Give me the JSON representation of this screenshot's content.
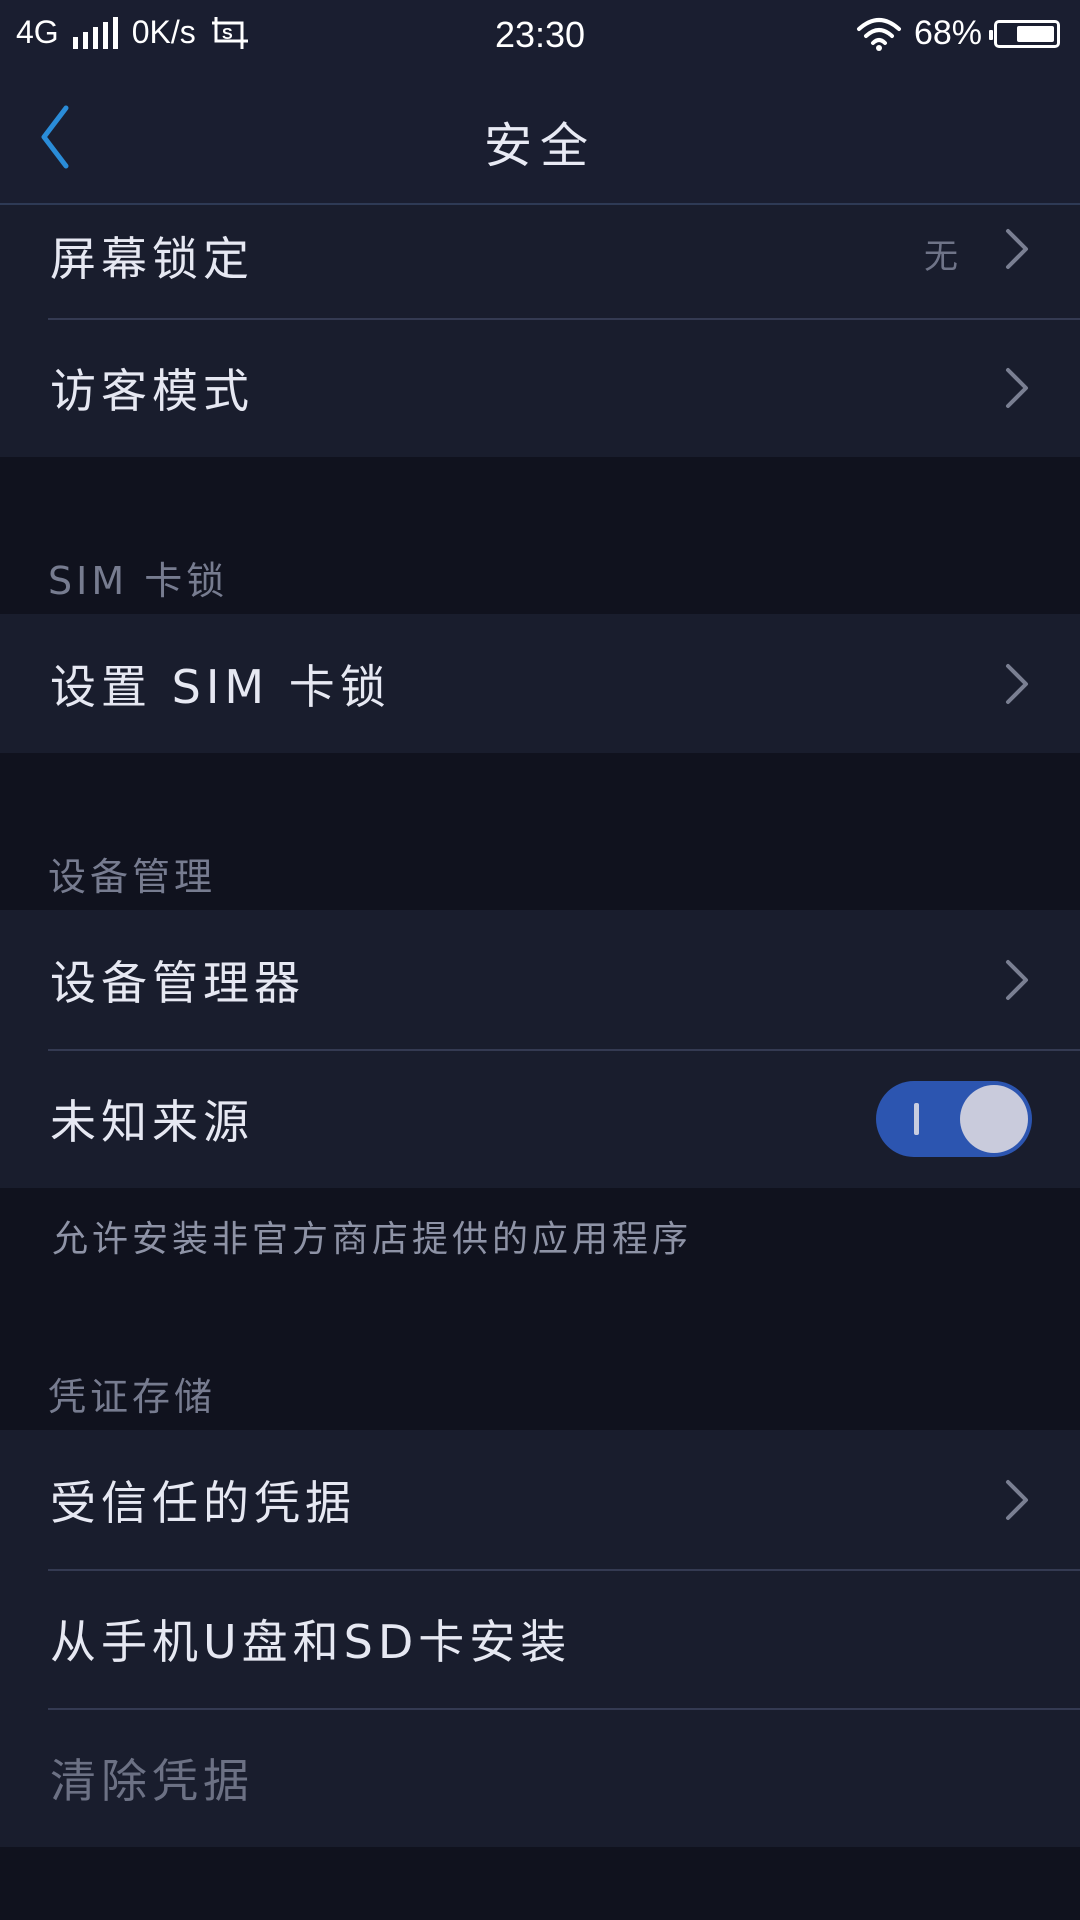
{
  "status_bar": {
    "network": "4G",
    "speed": "0K/s",
    "time": "23:30",
    "battery": "68%",
    "battery_level": 0.68
  },
  "header": {
    "title": "安全",
    "back_icon": "chevron-left-icon"
  },
  "colors": {
    "accent": "#2a8cd8",
    "toggle_on": "#2c55b0",
    "background": "#10121e",
    "row_background": "#191d2d"
  },
  "screen_lock": {
    "items": [
      {
        "label": "屏幕锁定",
        "value": "无"
      },
      {
        "label": "访客模式"
      }
    ]
  },
  "sim_lock": {
    "header": "SIM 卡锁",
    "items": [
      {
        "label": "设置 SIM 卡锁"
      }
    ]
  },
  "device_admin": {
    "header": "设备管理",
    "items": [
      {
        "label": "设备管理器"
      },
      {
        "label": "未知来源",
        "toggle": "on"
      }
    ],
    "helper": "允许安装非官方商店提供的应用程序"
  },
  "credential_storage": {
    "header": "凭证存储",
    "items": [
      {
        "label": "受信任的凭据"
      },
      {
        "label": "从手机U盘和SD卡安装"
      },
      {
        "label": "清除凭据",
        "disabled": true
      }
    ]
  }
}
